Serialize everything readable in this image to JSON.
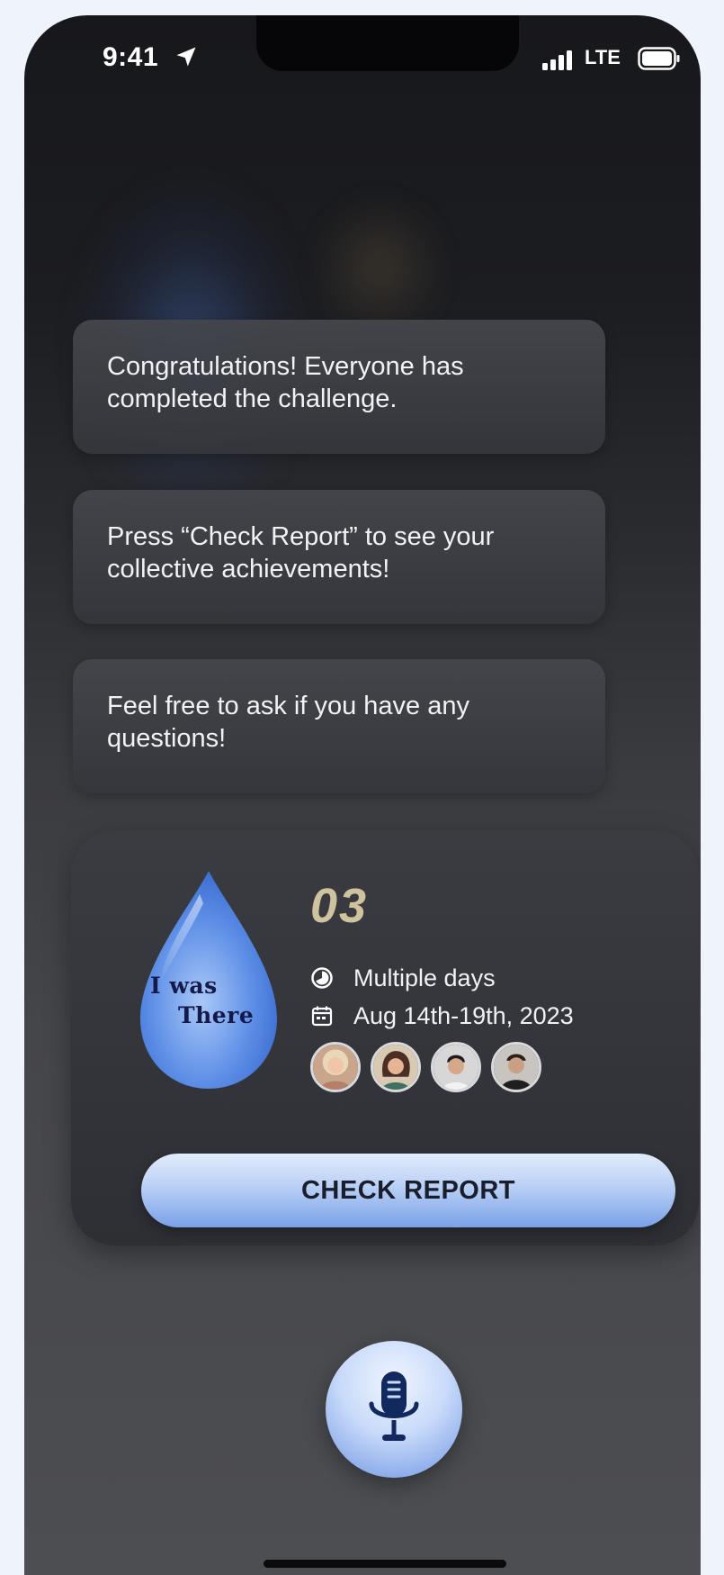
{
  "status_bar": {
    "time": "9:41",
    "network": "LTE",
    "icons": [
      "location-arrow-icon",
      "signal-bars-icon",
      "battery-icon"
    ]
  },
  "messages": [
    {
      "text": "Congratulations! Everyone has completed the challenge."
    },
    {
      "text": "Press “Check Report” to see your collective achievements!"
    },
    {
      "text": "Feel free to ask if you have any questions!"
    }
  ],
  "challenge_card": {
    "badge_text_line1": "I was",
    "badge_text_line2": "There",
    "number": "03",
    "duration": "Multiple days",
    "dates": "Aug 14th-19th, 2023",
    "participants": [
      "participant-1",
      "participant-2",
      "participant-3",
      "participant-4"
    ],
    "button_label": "CHECK REPORT"
  },
  "colors": {
    "accent_blue": "#7aa0e8",
    "number_gold": "#cfc29e",
    "bubble_bg": "#44464c"
  },
  "mic": {
    "icon": "microphone-icon"
  }
}
